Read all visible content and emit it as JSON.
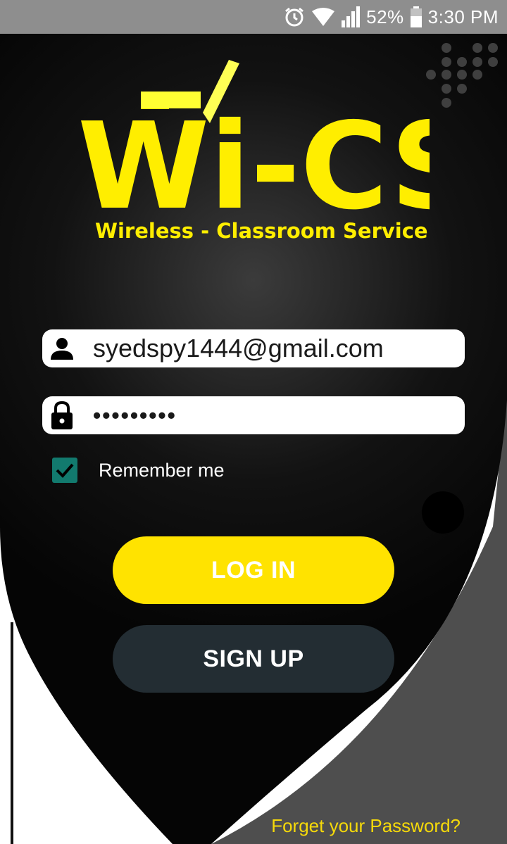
{
  "status_bar": {
    "battery_percent": "52%",
    "time": "3:30 PM",
    "icons": [
      "alarm-icon",
      "wifi-icon",
      "signal-icon",
      "battery-icon"
    ]
  },
  "logo": {
    "title": "Wi-CS",
    "tagline": "Wireless - Classroom Service"
  },
  "login_form": {
    "email_value": "syedspy1444@gmail.com",
    "password_value": "•••••••••",
    "remember_label": "Remember me",
    "remember_checked": true,
    "login_label": "LOG IN",
    "signup_label": "SIGN UP",
    "forgot_label": "Forget your Password?"
  },
  "colors": {
    "accent_yellow": "#ffe300",
    "dark_background": "#111111",
    "signup_button": "#232d33",
    "checkbox": "#127a6e",
    "gray_panel": "#4e4e4e"
  }
}
